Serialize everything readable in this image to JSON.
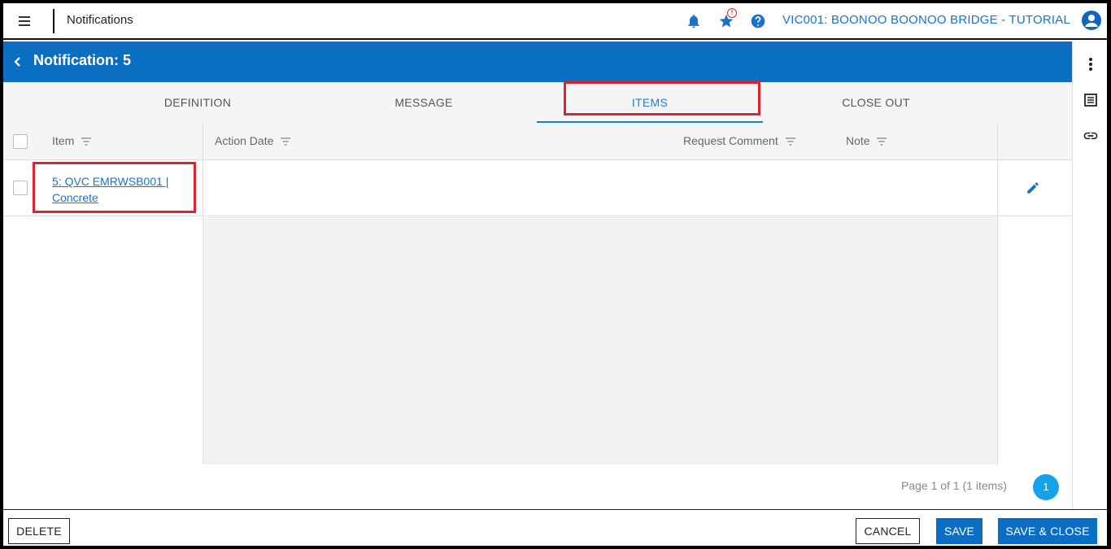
{
  "header": {
    "app_title": "Notifications",
    "project_label": "VIC001: BOONOO BOONOO BRIDGE - TUTORIAL",
    "notification_badge": "!"
  },
  "titlebar": {
    "title": "Notification: 5"
  },
  "tabs": [
    {
      "label": "DEFINITION",
      "active": false
    },
    {
      "label": "MESSAGE",
      "active": false
    },
    {
      "label": "ITEMS",
      "active": true
    },
    {
      "label": "CLOSE OUT",
      "active": false
    }
  ],
  "grid": {
    "columns": {
      "item": "Item",
      "action_date": "Action Date",
      "request_comment": "Request Comment",
      "note": "Note"
    },
    "rows": [
      {
        "item": "5: QVC EMRWSB001 | Concrete",
        "action_date": "",
        "request_comment": "",
        "note": ""
      }
    ]
  },
  "pager": {
    "info": "Page 1 of 1 (1 items)",
    "current_page": "1"
  },
  "footer": {
    "delete_label": "DELETE",
    "cancel_label": "CANCEL",
    "save_label": "SAVE",
    "save_close_label": "SAVE & CLOSE"
  },
  "colors": {
    "primary": "#0a6fc2",
    "link": "#1a73c9",
    "annotation": "#d9262e",
    "pager": "#13a3ea"
  }
}
